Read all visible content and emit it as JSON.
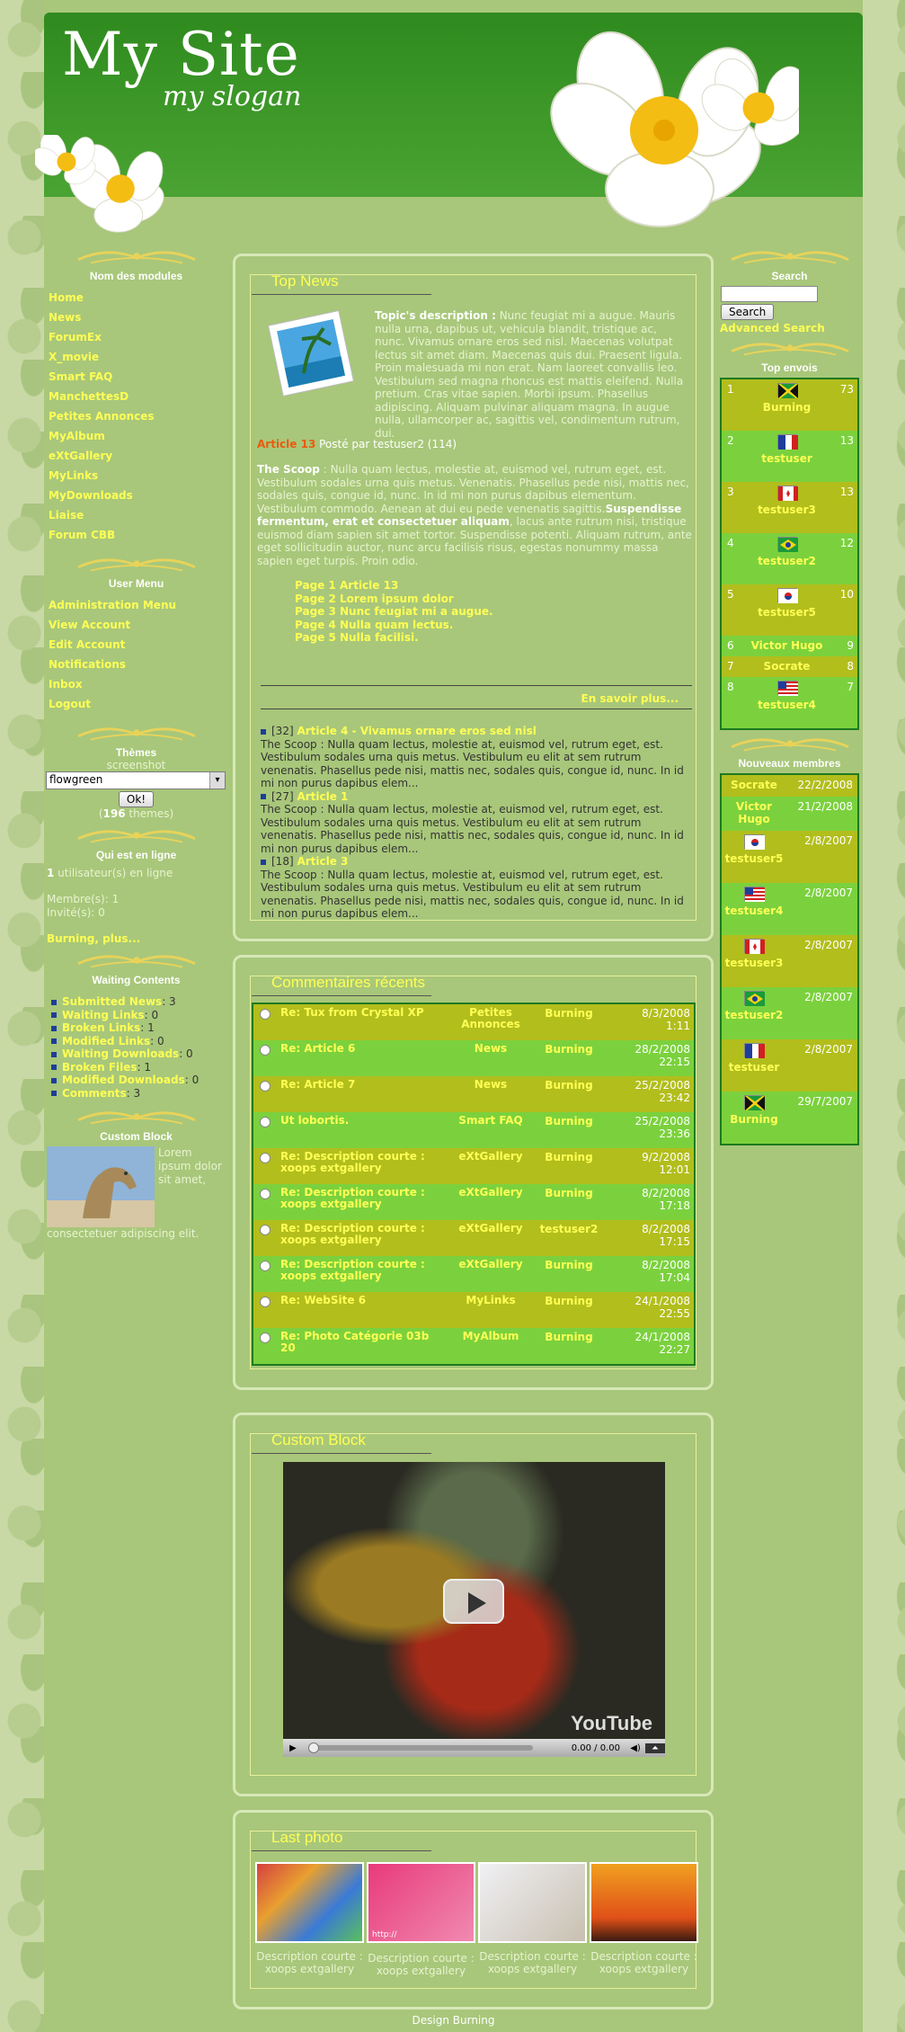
{
  "header": {
    "title": "My Site",
    "slogan": "my slogan"
  },
  "left": {
    "modules_title": "Nom des modules",
    "modules": [
      "Home",
      "News",
      "ForumEx",
      "X_movie",
      "Smart FAQ",
      "ManchettesD",
      "Petites Annonces",
      "MyAlbum",
      "eXtGallery",
      "MyLinks",
      "MyDownloads",
      "Liaise",
      "Forum CBB"
    ],
    "user_menu_title": "User Menu",
    "user_menu": [
      "Administration Menu",
      "View Account",
      "Edit Account",
      "Notifications",
      "Inbox",
      "Logout"
    ],
    "themes_title": "Thèmes",
    "themes_screenshot": "screenshot",
    "theme_selected": "flowgreen",
    "theme_ok": "Ok!",
    "theme_count_open": "(",
    "theme_count": "196",
    "theme_count_close": " themes)",
    "online_title": "Qui est en ligne",
    "online_count": "1",
    "online_text": " utilisateur(s) en ligne",
    "members_line": "Membre(s): 1",
    "guests_line": "Invité(s): 0",
    "online_names": "Burning, plus...",
    "waiting_title": "Waiting Contents",
    "waiting": [
      {
        "label": "Submitted News",
        "value": ": 3"
      },
      {
        "label": "Waiting Links",
        "value": ": 0"
      },
      {
        "label": "Broken Links",
        "value": ": 1"
      },
      {
        "label": "Modified Links",
        "value": ": 0"
      },
      {
        "label": "Waiting Downloads",
        "value": ": 0"
      },
      {
        "label": "Broken Files",
        "value": ": 1"
      },
      {
        "label": "Modified Downloads",
        "value": ": 0"
      },
      {
        "label": "Comments",
        "value": ": 3"
      }
    ],
    "custom_title": "Custom Block",
    "custom_text": "Lorem ipsum dolor sit amet, consectetuer adipiscing elit."
  },
  "news": {
    "title": "Top News",
    "topic_label": "Topic's description :",
    "topic_text": " Nunc feugiat mi a augue. Mauris nulla urna, dapibus ut, vehicula blandit, tristique ac, nunc. Vivamus ornare eros sed nisl. Maecenas volutpat lectus sit amet diam. Maecenas quis dui. Praesent ligula. Proin malesuada mi non erat. Nam laoreet convallis leo. Vestibulum sed magna rhoncus est mattis eleifend. Nulla pretium. Cras vitae sapien. Morbi ipsum. Phasellus adipiscing. Aliquam pulvinar aliquam magna. In augue nulla, ullamcorper ac, sagittis vel, condimentum rutrum, dui.",
    "article_title": "Article 13",
    "article_meta": " Posté par testuser2 (114)",
    "scoop_label": "The Scoop",
    "scoop_text": " : Nulla quam lectus, molestie at, euismod vel, rutrum eget, est. Vestibulum sodales urna quis metus. Venenatis. Phasellus pede nisi, mattis nec, sodales quis, congue id, nunc. In id mi non purus dapibus elementum. Vestibulum commodo. Aenean at dui eu pede venenatis sagittis.",
    "bold_text": "Suspendisse fermentum, erat et consectetuer aliquam",
    "rest_text": ", lacus ante rutrum nisi, tristique euismod diam sapien sit amet tortor. Suspendisse potenti. Aliquam rutrum, ante eget sollicitudin auctor, nunc arcu facilisis risus, egestas nonummy massa sapien eget turpis. Proin odio.",
    "pages": [
      "Page 1 Article 13",
      "Page 2 Lorem ipsum dolor",
      "Page 3 Nunc feugiat mi a augue.",
      "Page 4 Nulla quam lectus.",
      "Page 5 Nulla facilisi."
    ],
    "read_more": "En savoir plus...",
    "more": [
      {
        "count": "[32]",
        "title": "Article 4 - Vivamus ornare eros sed nisl",
        "text": "The Scoop : Nulla quam lectus, molestie at, euismod vel, rutrum eget, est. Vestibulum sodales urna quis metus. Vestibulum eu elit at sem rutrum venenatis. Phasellus pede nisi, mattis nec, sodales quis, congue id, nunc. In id mi non purus dapibus elem..."
      },
      {
        "count": "[27]",
        "title": "Article 1",
        "text": "The Scoop : Nulla quam lectus, molestie at, euismod vel, rutrum eget, est. Vestibulum sodales urna quis metus. Vestibulum eu elit at sem rutrum venenatis. Phasellus pede nisi, mattis nec, sodales quis, congue id, nunc. In id mi non purus dapibus elem..."
      },
      {
        "count": "[18]",
        "title": "Article 3",
        "text": "The Scoop : Nulla quam lectus, molestie at, euismod vel, rutrum eget, est. Vestibulum sodales urna quis metus. Vestibulum eu elit at sem rutrum venenatis. Phasellus pede nisi, mattis nec, sodales quis, congue id, nunc. In id mi non purus dapibus elem..."
      }
    ]
  },
  "comments": {
    "title": "Commentaires récents",
    "rows": [
      {
        "title": "Re: Tux from Crystal XP",
        "module": "Petites Annonces",
        "user": "Burning",
        "date": "8/3/2008",
        "time": "1:11"
      },
      {
        "title": "Re: Article 6",
        "module": "News",
        "user": "Burning",
        "date": "28/2/2008",
        "time": "22:15"
      },
      {
        "title": "Re: Article 7",
        "module": "News",
        "user": "Burning",
        "date": "25/2/2008",
        "time": "23:42"
      },
      {
        "title": "Ut lobortis.",
        "module": "Smart FAQ",
        "user": "Burning",
        "date": "25/2/2008",
        "time": "23:36"
      },
      {
        "title": "Re: Description courte : xoops extgallery",
        "module": "eXtGallery",
        "user": "Burning",
        "date": "9/2/2008",
        "time": "12:01"
      },
      {
        "title": "Re: Description courte : xoops extgallery",
        "module": "eXtGallery",
        "user": "Burning",
        "date": "8/2/2008",
        "time": "17:18"
      },
      {
        "title": "Re: Description courte : xoops extgallery",
        "module": "eXtGallery",
        "user": "testuser2",
        "date": "8/2/2008",
        "time": "17:15"
      },
      {
        "title": "Re: Description courte : xoops extgallery",
        "module": "eXtGallery",
        "user": "Burning",
        "date": "8/2/2008",
        "time": "17:04"
      },
      {
        "title": "Re: WebSite 6",
        "module": "MyLinks",
        "user": "Burning",
        "date": "24/1/2008",
        "time": "22:55"
      },
      {
        "title": "Re: Photo Catégorie 03b 20",
        "module": "MyAlbum",
        "user": "Burning",
        "date": "24/1/2008",
        "time": "22:27"
      }
    ]
  },
  "video": {
    "title": "Custom Block",
    "time": "0.00 / 0.00",
    "brand": "YouTube"
  },
  "photos": {
    "title": "Last photo",
    "items": [
      {
        "caption": "Description courte : xoops extgallery"
      },
      {
        "caption": "Description courte : xoops extgallery"
      },
      {
        "caption": "Description courte : xoops extgallery"
      },
      {
        "caption": "Description courte : xoops extgallery"
      }
    ],
    "url_overlay": "http://"
  },
  "right": {
    "search_title": "Search",
    "search_button": "Search",
    "advanced_search": "Advanced Search",
    "top_title": "Top envois",
    "top": [
      {
        "rank": "1",
        "name": "Burning",
        "count": "73",
        "flag": "jamaica"
      },
      {
        "rank": "2",
        "name": "testuser",
        "count": "13",
        "flag": "france"
      },
      {
        "rank": "3",
        "name": "testuser3",
        "count": "13",
        "flag": "canada"
      },
      {
        "rank": "4",
        "name": "testuser2",
        "count": "12",
        "flag": "brazil"
      },
      {
        "rank": "5",
        "name": "testuser5",
        "count": "10",
        "flag": "korea"
      },
      {
        "rank": "6",
        "name": "Victor Hugo",
        "count": "9",
        "flag": ""
      },
      {
        "rank": "7",
        "name": "Socrate",
        "count": "8",
        "flag": ""
      },
      {
        "rank": "8",
        "name": "testuser4",
        "count": "7",
        "flag": "usa"
      }
    ],
    "new_title": "Nouveaux membres",
    "new": [
      {
        "name": "Socrate",
        "date": "22/2/2008",
        "flag": ""
      },
      {
        "name": "Victor Hugo",
        "date": "21/2/2008",
        "flag": ""
      },
      {
        "name": "testuser5",
        "date": "2/8/2007",
        "flag": "korea"
      },
      {
        "name": "testuser4",
        "date": "2/8/2007",
        "flag": "usa"
      },
      {
        "name": "testuser3",
        "date": "2/8/2007",
        "flag": "canada"
      },
      {
        "name": "testuser2",
        "date": "2/8/2007",
        "flag": "brazil"
      },
      {
        "name": "testuser",
        "date": "2/8/2007",
        "flag": "france"
      },
      {
        "name": "Burning",
        "date": "29/7/2007",
        "flag": "jamaica"
      }
    ]
  },
  "footer": "Design Burning"
}
